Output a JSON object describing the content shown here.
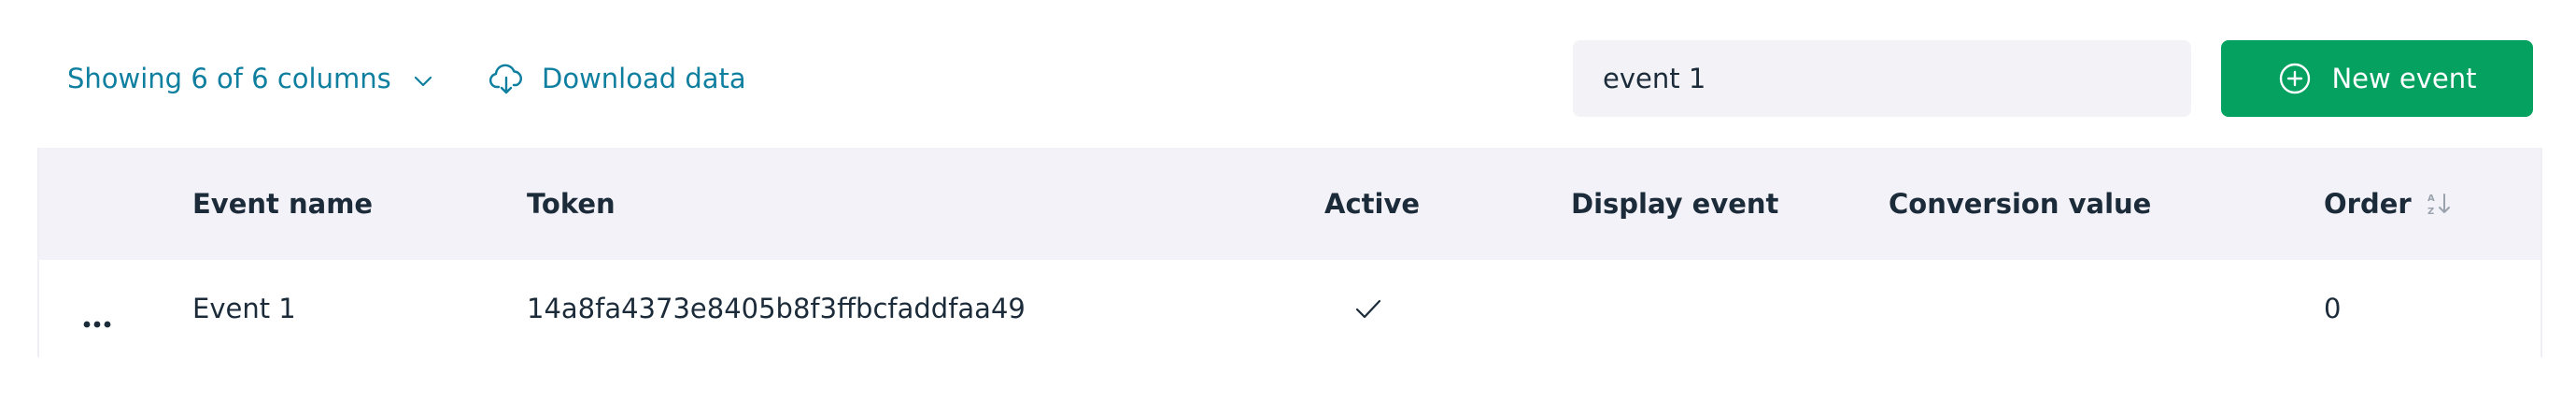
{
  "toolbar": {
    "columns_label": "Showing 6 of 6 columns",
    "download_label": "Download data",
    "search_value": "event 1",
    "new_event_label": "New event"
  },
  "colors": {
    "link": "#0f7fa0",
    "primary": "#05a160",
    "header_bg": "#f3f2f8",
    "input_bg": "#f3f3f7",
    "text": "#1c2b39"
  },
  "icons": {
    "columns_toggle": "chevron-down-icon",
    "download": "cloud-download-icon",
    "new_event": "plus-circle-icon",
    "sort": "sort-az-icon",
    "row_menu": "more-horizontal-icon",
    "active": "check-icon"
  },
  "table": {
    "columns": [
      "Event name",
      "Token",
      "Active",
      "Display event",
      "Conversion value",
      "Order"
    ],
    "rows": [
      {
        "event_name": "Event 1",
        "token": "14a8fa4373e8405b8f3ffbcfaddfaa49",
        "active": true,
        "display_event": "",
        "conversion_value": "",
        "order": "0"
      }
    ]
  }
}
